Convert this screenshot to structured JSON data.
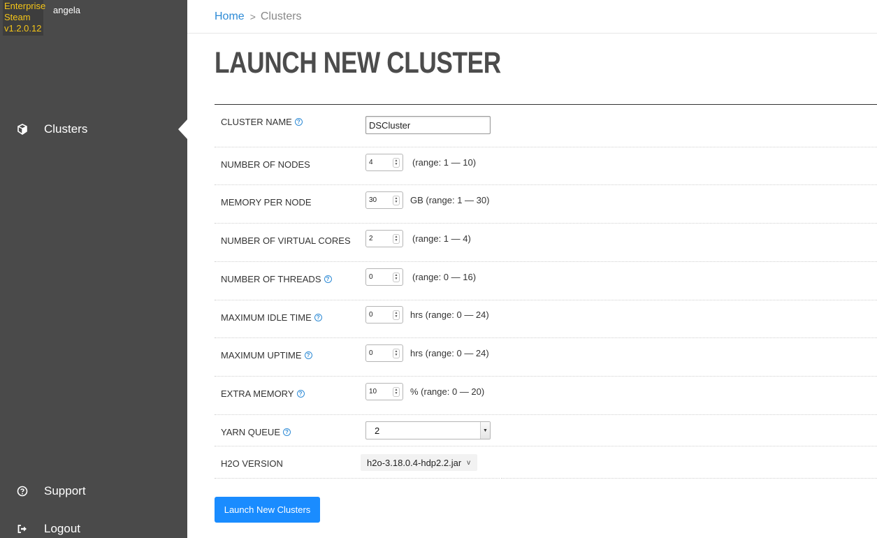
{
  "brand": {
    "line1": "Enterprise",
    "line2": "Steam",
    "version": "v1.2.0.12",
    "color": "#f5c518"
  },
  "user": {
    "name": "angela"
  },
  "sidebar": {
    "items": [
      {
        "label": "Clusters",
        "icon": "cube-icon",
        "active": true
      },
      {
        "label": "Support",
        "icon": "help-circle-icon"
      },
      {
        "label": "Logout",
        "icon": "logout-icon"
      }
    ]
  },
  "breadcrumb": {
    "home": "Home",
    "separator": ">",
    "current": "Clusters"
  },
  "page": {
    "title": "LAUNCH NEW CLUSTER"
  },
  "form": {
    "cluster_name": {
      "label": "CLUSTER NAME",
      "value": "DSCluster"
    },
    "nodes": {
      "label": "NUMBER OF NODES",
      "value": "4",
      "hint": "(range: 1 — 10)"
    },
    "memory": {
      "label": "MEMORY PER NODE",
      "value": "30",
      "hint": "GB (range: 1 — 30)"
    },
    "vcores": {
      "label": "NUMBER OF VIRTUAL CORES",
      "value": "2",
      "hint": "(range: 1 — 4)"
    },
    "threads": {
      "label": "NUMBER OF THREADS",
      "value": "0",
      "hint": "(range: 0 — 16)"
    },
    "idle": {
      "label": "MAXIMUM IDLE TIME",
      "value": "0",
      "hint": "hrs (range: 0 — 24)"
    },
    "uptime": {
      "label": "MAXIMUM UPTIME",
      "value": "0",
      "hint": "hrs (range: 0 — 24)"
    },
    "extra_memory": {
      "label": "EXTRA MEMORY",
      "value": "10",
      "hint": "% (range: 0 — 20)"
    },
    "yarn_queue": {
      "label": "YARN QUEUE",
      "value": "2"
    },
    "h2o_version": {
      "label": "H2O VERSION",
      "value": "h2o-3.18.0.4-hdp2.2.jar"
    }
  },
  "actions": {
    "launch_label": "Launch New Clusters",
    "accent": "#1a8cff"
  }
}
